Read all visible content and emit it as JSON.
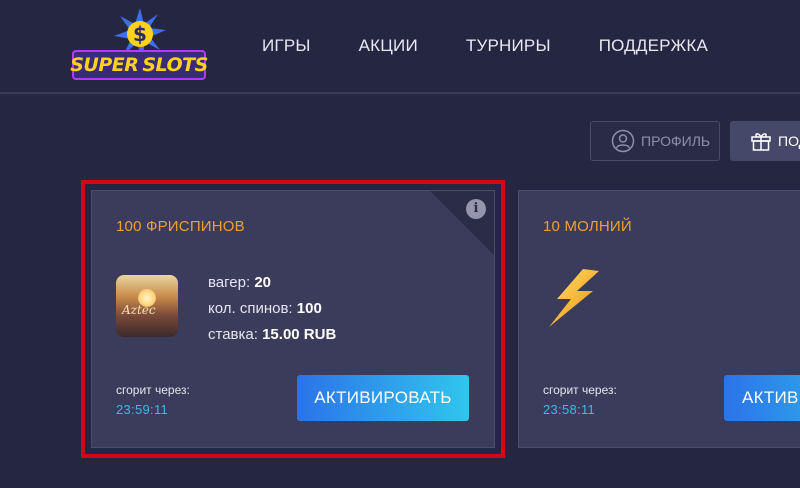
{
  "logo": {
    "word1": "SUPER",
    "word2": "SLOTS"
  },
  "nav": [
    "ИГРЫ",
    "АКЦИИ",
    "ТУРНИРЫ",
    "ПОДДЕРЖКА"
  ],
  "actions": {
    "profile": "ПРОФИЛЬ",
    "gifts": "ПОД"
  },
  "cards": [
    {
      "title": "100 ФРИСПИНОВ",
      "wager_label": "вагер:",
      "wager_value": "20",
      "spins_label": "кол. спинов:",
      "spins_value": "100",
      "bet_label": "ставка:",
      "bet_value": "15.00 RUB",
      "game_thumb_text": "Aztec",
      "expire_label": "сгорит через:",
      "expire_time": "23:59:11",
      "button": "АКТИВИРОВАТЬ",
      "info_icon": "i"
    },
    {
      "title": "10 МОЛНИЙ",
      "expire_label": "сгорит через:",
      "expire_time": "23:58:11",
      "button": "АКТИВ"
    }
  ],
  "colors": {
    "background": "#252642",
    "card": "#3b3c5b",
    "title_orange": "#f0a030",
    "timer_blue": "#3fb8e8",
    "highlight_red": "#d00a14"
  }
}
